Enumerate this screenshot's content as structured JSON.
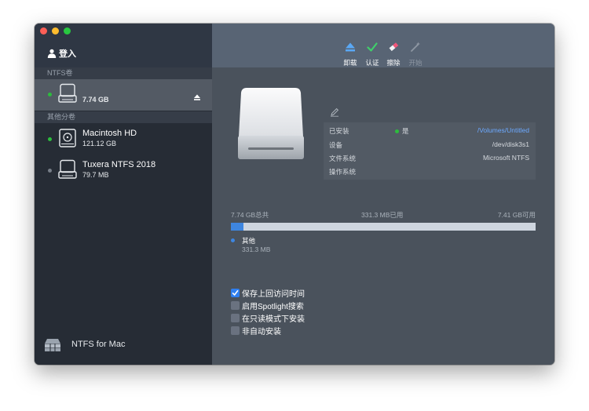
{
  "sidebar": {
    "login_label": "登入",
    "sections": {
      "ntfs": "NTFS卷",
      "other": "其他分卷"
    },
    "volumes": [
      {
        "name": "",
        "size": "7.74 GB",
        "selected": true,
        "status": "mounted"
      },
      {
        "name": "Macintosh HD",
        "size": "121.12 GB",
        "selected": false,
        "status": "mounted"
      },
      {
        "name": "Tuxera NTFS 2018",
        "size": "79.7 MB",
        "selected": false,
        "status": "unmounted"
      }
    ],
    "footer_label": "NTFS for Mac"
  },
  "toolbar": {
    "eject_label": "卸载",
    "verify_label": "认证",
    "erase_label": "擦除",
    "start_label": "开始"
  },
  "info": {
    "mounted_key": "已安装",
    "mounted_value": "是",
    "mount_path": "/Volumes/Untitled",
    "device_key": "设备",
    "device_value": "/dev/disk3s1",
    "filesystem_key": "文件系统",
    "filesystem_value": "Microsoft NTFS",
    "os_key": "操作系统",
    "os_value": ""
  },
  "usage": {
    "total": "7.74 GB总共",
    "used": "331.3 MB已用",
    "free": "7.41 GB可用",
    "used_fraction": 0.042,
    "legend_label": "其他",
    "legend_size": "331.3 MB"
  },
  "options": [
    {
      "label": "保存上回访问时间",
      "checked": true
    },
    {
      "label": "启用Spotlight搜索",
      "checked": false
    },
    {
      "label": "在只读模式下安装",
      "checked": false
    },
    {
      "label": "非自动安装",
      "checked": false
    }
  ],
  "colors": {
    "accent": "#3e86e0",
    "mounted_green": "#2cbc3d",
    "link": "#6ca9ff"
  }
}
